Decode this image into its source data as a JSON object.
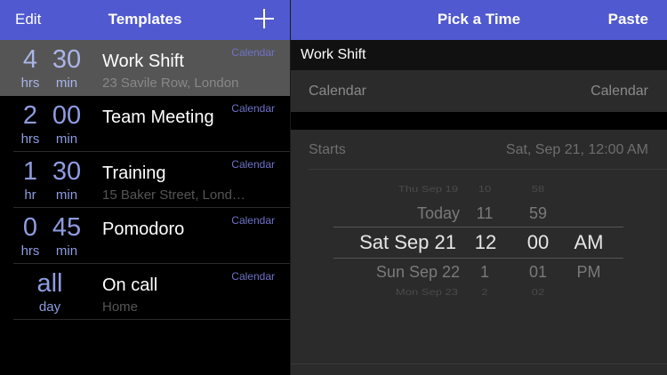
{
  "left_nav": {
    "edit": "Edit",
    "title": "Templates"
  },
  "right_nav": {
    "title": "Pick a Time",
    "paste": "Paste"
  },
  "templates": [
    {
      "num1": "4",
      "unit1": "hrs",
      "num2": "30",
      "unit2": "min",
      "title": "Work Shift",
      "subtitle": "23 Savile Row, London",
      "calendar": "Calendar",
      "selected": true
    },
    {
      "num1": "2",
      "unit1": "hrs",
      "num2": "00",
      "unit2": "min",
      "title": "Team Meeting",
      "subtitle": "",
      "calendar": "Calendar"
    },
    {
      "num1": "1",
      "unit1": "hr",
      "num2": "30",
      "unit2": "min",
      "title": "Training",
      "subtitle": "15 Baker Street, Lond…",
      "calendar": "Calendar"
    },
    {
      "num1": "0",
      "unit1": "hrs",
      "num2": "45",
      "unit2": "min",
      "title": "Pomodoro",
      "subtitle": "",
      "calendar": "Calendar"
    },
    {
      "num1": "all",
      "unit1": "day",
      "num2": "",
      "unit2": "",
      "title": "On call",
      "subtitle": "Home",
      "calendar": "Calendar"
    }
  ],
  "detail": {
    "name": "Work Shift",
    "calendar_label": "Calendar",
    "calendar_value": "Calendar",
    "starts_label": "Starts",
    "starts_value": "Sat, Sep 21, 12:00 AM"
  },
  "picker": {
    "rows": [
      {
        "date": "Thu Sep 19",
        "hour": "10",
        "minute": "58",
        "ampm": ""
      },
      {
        "date": "Today",
        "hour": "11",
        "minute": "59",
        "ampm": ""
      },
      {
        "date": "Sat Sep 21",
        "hour": "12",
        "minute": "00",
        "ampm": "AM"
      },
      {
        "date": "Sun Sep 22",
        "hour": "1",
        "minute": "01",
        "ampm": "PM"
      },
      {
        "date": "Mon Sep 23",
        "hour": "2",
        "minute": "02",
        "ampm": ""
      }
    ],
    "selected_index": 2
  },
  "colors": {
    "nav": "#5059cf",
    "accent": "#8e9ce0",
    "calendar_tag": "#6f72c8"
  }
}
